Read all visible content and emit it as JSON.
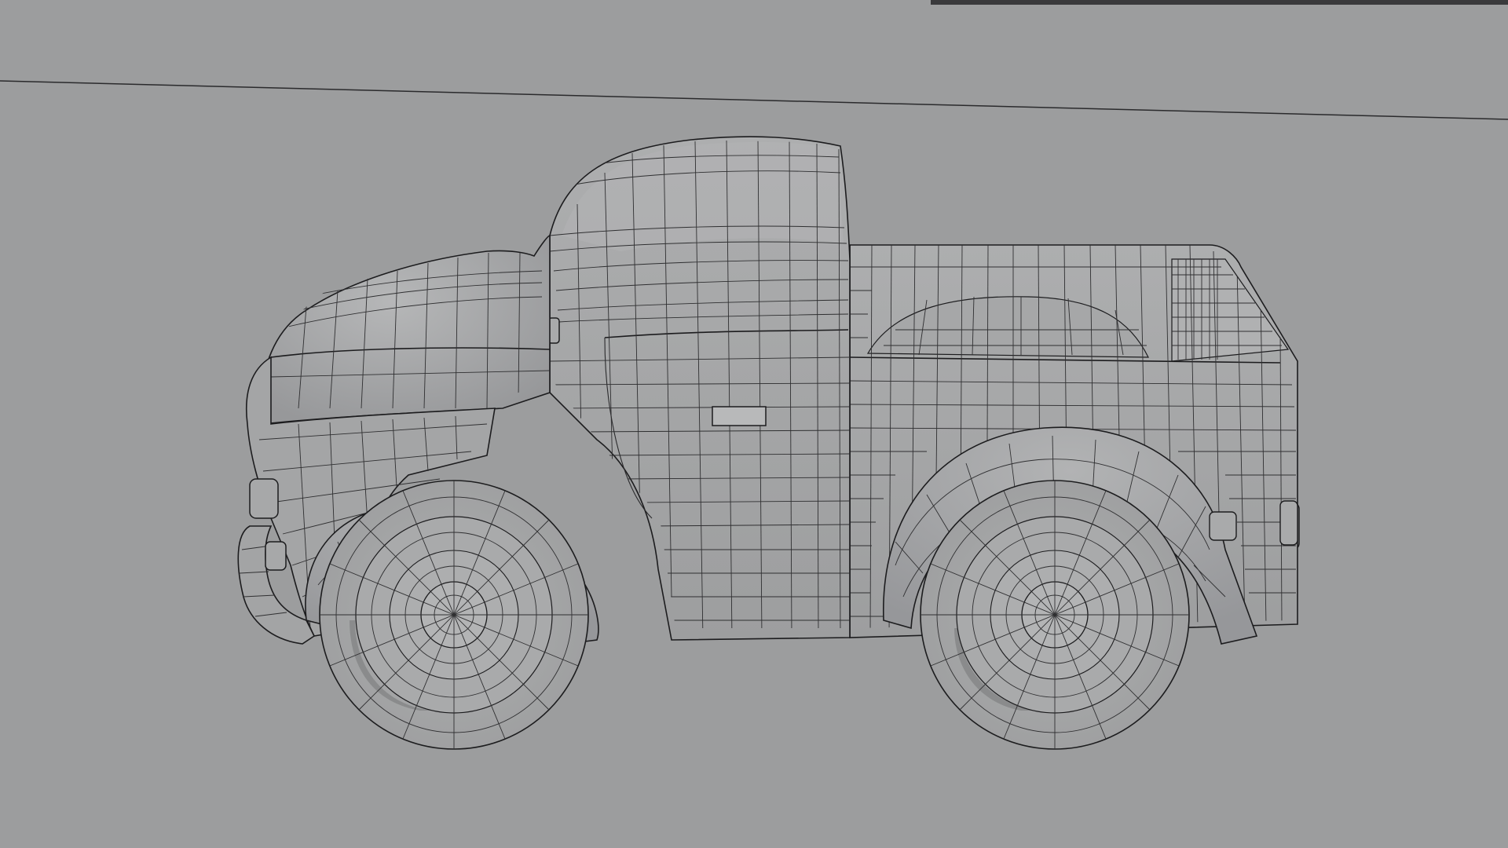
{
  "viewport": {
    "background": "#9c9d9e",
    "horizon_color": "#2a2a2c",
    "mesh_fill": "#a6a7a8",
    "mesh_shade": "#8e8f90",
    "mesh_light": "#b4b5b6",
    "wire_color": "#2a2a2c"
  },
  "scene": {
    "object": "pickup-truck-wireframe-mesh",
    "view": "side"
  }
}
